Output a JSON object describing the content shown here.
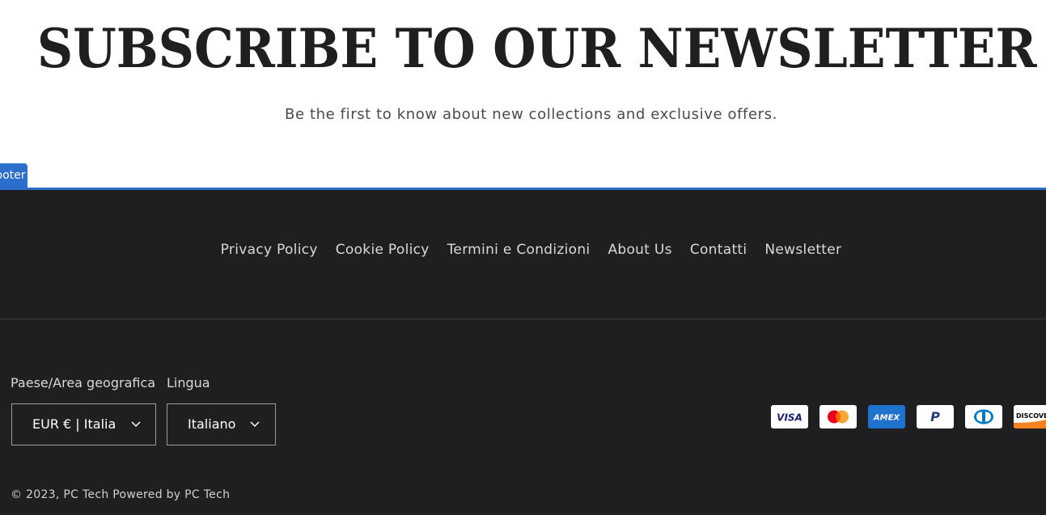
{
  "newsletter": {
    "title": "SUBSCRIBE TO OUR NEWSLETTER",
    "subtitle": "Be the first to know about new collections and exclusive offers."
  },
  "footer_tab": {
    "label": "Footer"
  },
  "footer": {
    "links": [
      "Privacy Policy",
      "Cookie Policy",
      "Termini e Condizioni",
      "About Us",
      "Contatti",
      "Newsletter"
    ],
    "country": {
      "label": "Paese/Area geografica",
      "value": "EUR € | Italia",
      "icon": "chevron-down-icon"
    },
    "language": {
      "label": "Lingua",
      "value": "Italiano",
      "icon": "chevron-down-icon"
    },
    "payment_methods": [
      {
        "name": "Visa",
        "text": "VISA",
        "color": "#1a1f71",
        "bg": "#ffffff"
      },
      {
        "name": "Mastercard",
        "text": "",
        "color": "#eb001b",
        "bg": "#ffffff"
      },
      {
        "name": "American Express",
        "text": "AMEX",
        "color": "#ffffff",
        "bg": "#1f72cd"
      },
      {
        "name": "PayPal",
        "text": "P",
        "color": "#253b80",
        "bg": "#ffffff"
      },
      {
        "name": "Diners Club",
        "text": "",
        "color": "#0079be",
        "bg": "#ffffff"
      },
      {
        "name": "Discover",
        "text": "DISCOVER",
        "color": "#000000",
        "bg": "#ffffff"
      }
    ],
    "copyright": "© 2023, PC Tech Powered by PC Tech"
  },
  "colors": {
    "footer_bg": "#1f1f21",
    "accent": "#2c6ecb",
    "title": "#1f1f21"
  }
}
